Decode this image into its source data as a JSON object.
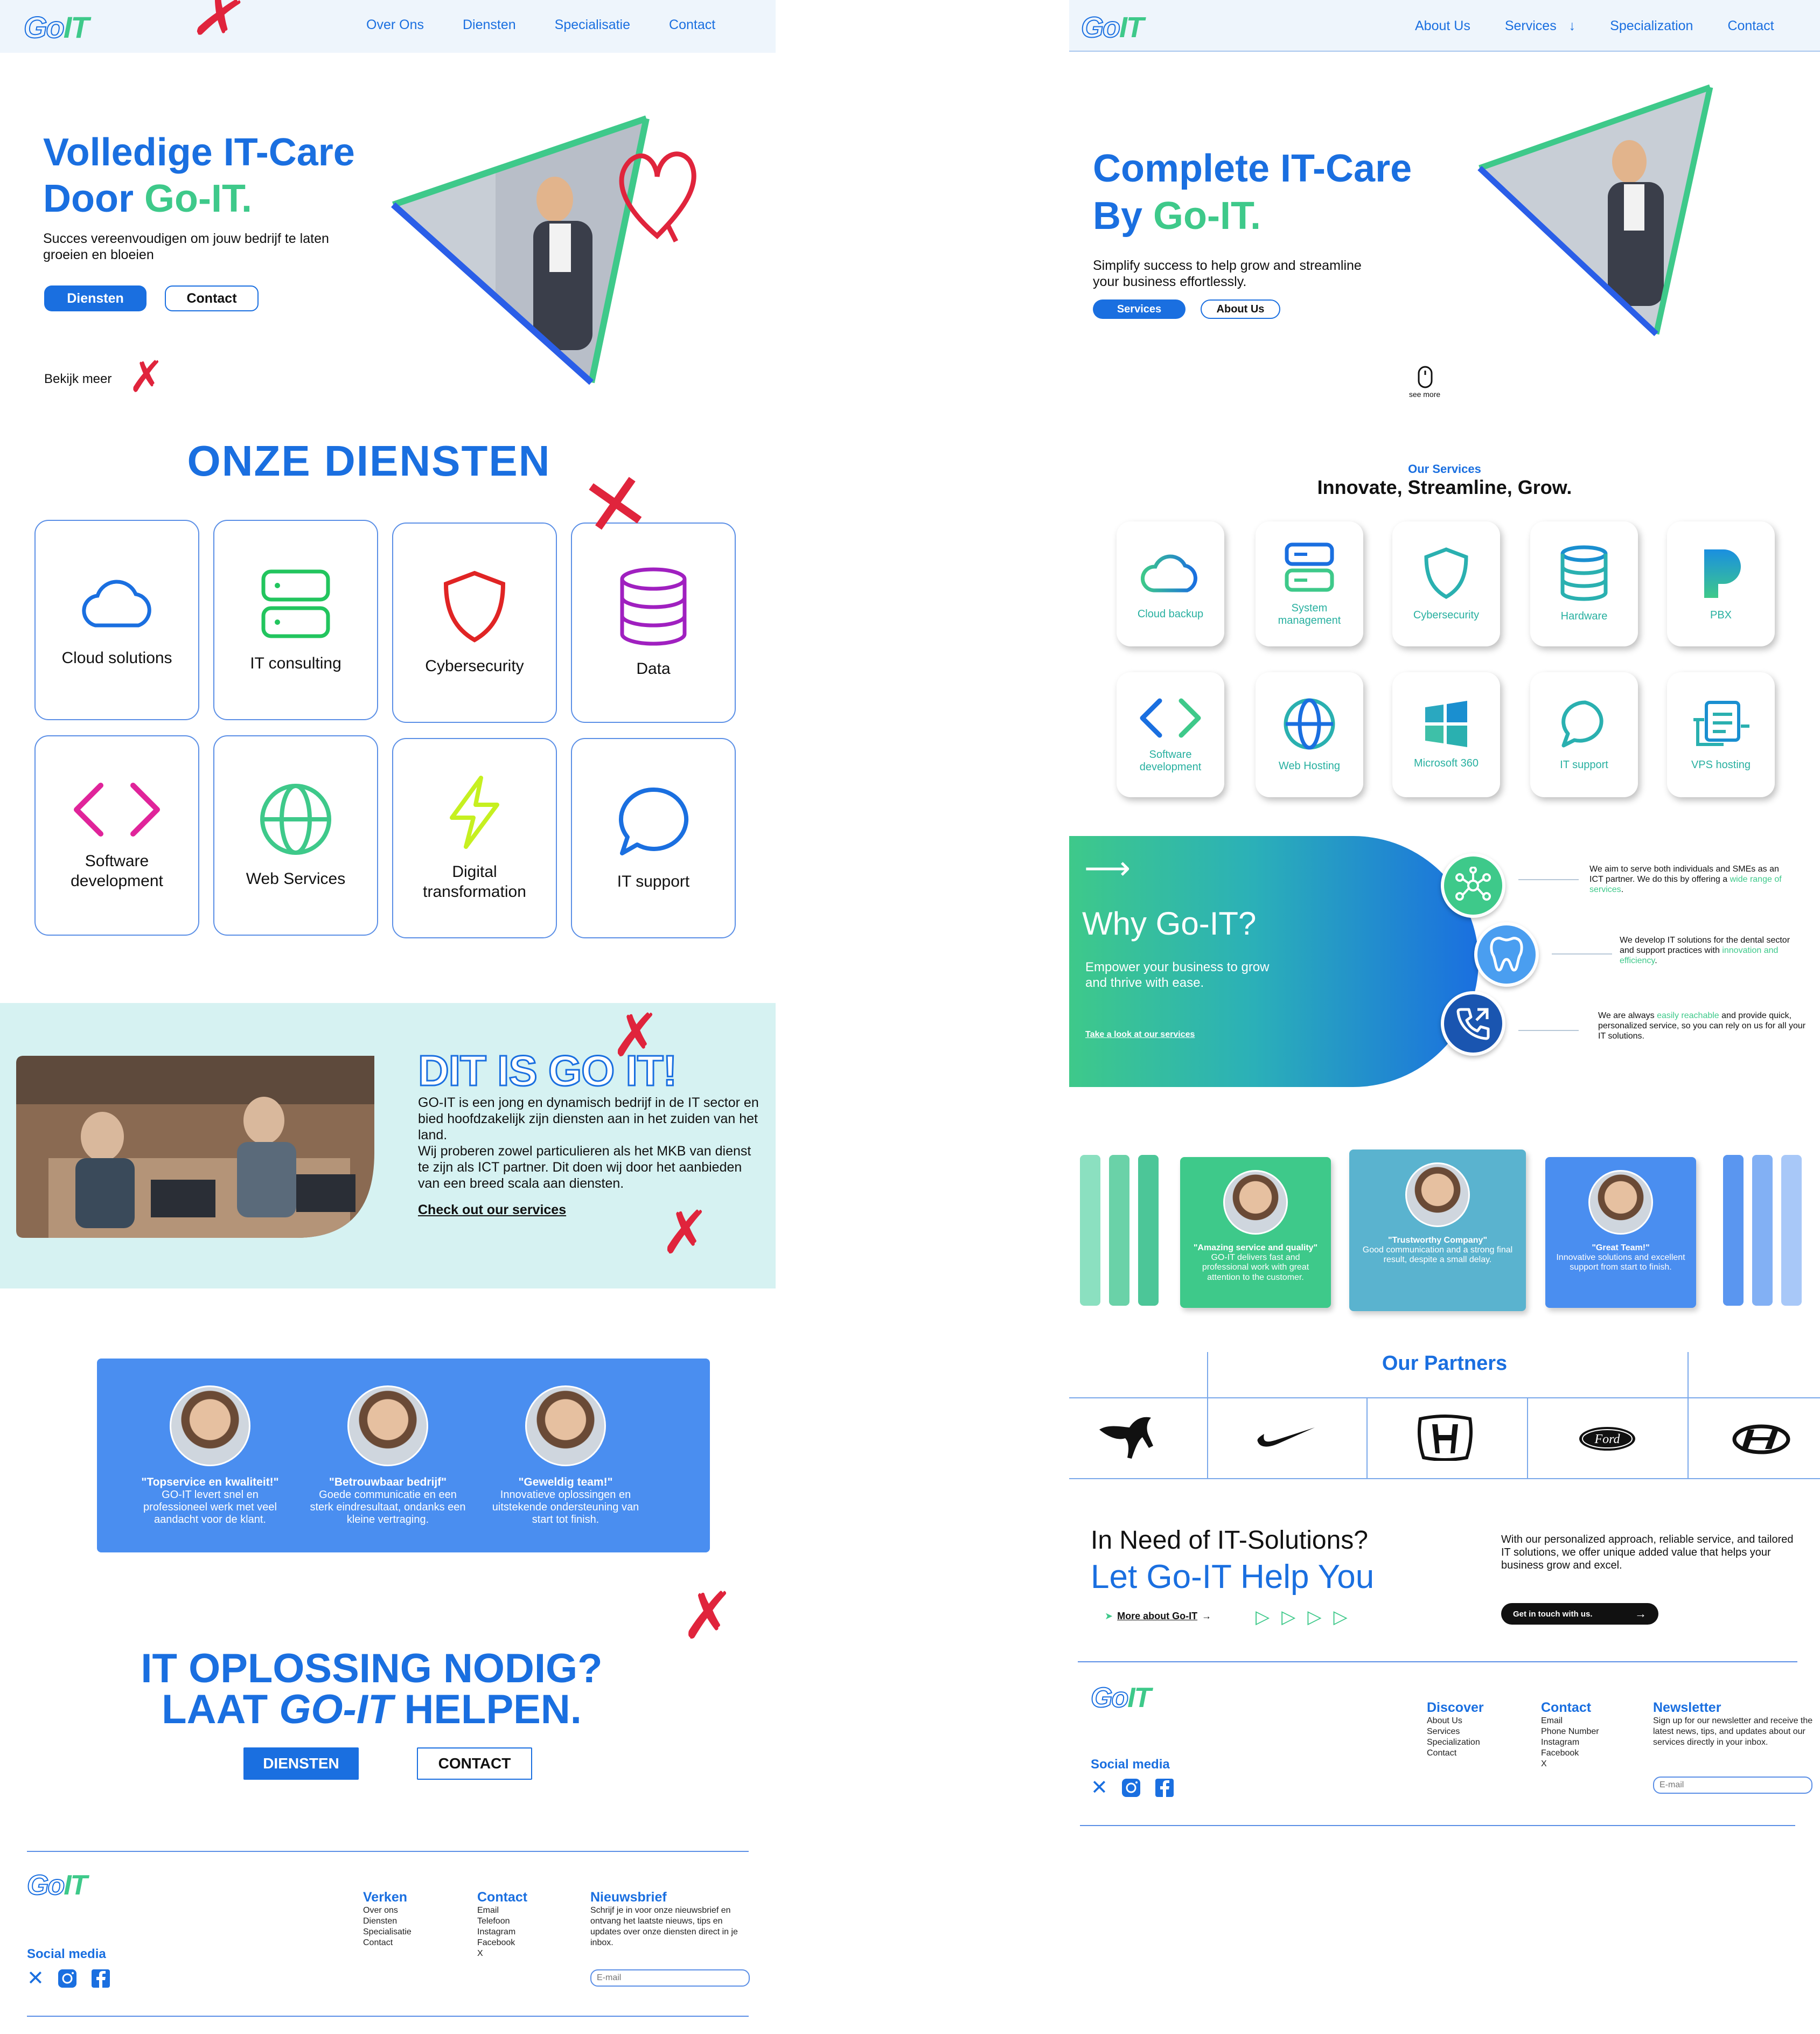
{
  "left": {
    "logo": {
      "go": "Go",
      "it": "IT"
    },
    "nav": [
      "Over Ons",
      "Diensten",
      "Specialisatie",
      "Contact"
    ],
    "hero": {
      "title_line1": "Volledige IT-Care",
      "title_door": "Door ",
      "title_brand": "Go-IT.",
      "subtitle": "Succes vereenvoudigen om jouw bedrijf te laten groeien en bloeien",
      "btn_primary": "Diensten",
      "btn_secondary": "Contact",
      "see_more": "Bekijk meer"
    },
    "services": {
      "heading": "ONZE DIENSTEN",
      "items": [
        {
          "label": "Cloud solutions",
          "icon": "cloud-icon",
          "color": "#1a6fe0"
        },
        {
          "label": "IT consulting",
          "icon": "server-icon",
          "color": "#22c55e"
        },
        {
          "label": "Cybersecurity",
          "icon": "shield-icon",
          "color": "#e02424"
        },
        {
          "label": "Data",
          "icon": "database-icon",
          "color": "#a020c0"
        },
        {
          "label": "Software development",
          "icon": "code-icon",
          "color": "#e0249a"
        },
        {
          "label": "Web Services",
          "icon": "globe-icon",
          "color": "#3ec98a"
        },
        {
          "label": "Digital transformation",
          "icon": "lightning-icon",
          "color": "#c6f020"
        },
        {
          "label": "IT support",
          "icon": "chat-bubble-icon",
          "color": "#1a6fe0"
        }
      ]
    },
    "about": {
      "title": "DIT IS GO IT!",
      "body1": "GO-IT is een jong en dynamisch bedrijf in de IT sector en bied hoofdzakelijk zijn diensten aan in het zuiden van het land.",
      "body2": "Wij proberen zowel particulieren als het MKB van dienst te zijn als ICT partner. Dit doen wij door het aanbieden van een  breed scala aan diensten.",
      "link": "Check out our services",
      "bg": "#d6f2f2"
    },
    "testimonials": [
      {
        "quote": "\"Topservice en kwaliteit!\"",
        "text": "GO-IT levert snel en professioneel werk met veel aandacht voor de klant."
      },
      {
        "quote": "\"Betrouwbaar bedrijf\"",
        "text": "Goede communicatie en een sterk eindresultaat, ondanks een kleine vertraging."
      },
      {
        "quote": "\"Geweldig team!\"",
        "text": "Innovatieve oplossingen en uitstekende ondersteuning van start tot finish."
      }
    ],
    "cta": {
      "line1": "IT OPLOSSING NODIG?",
      "line2_a": "LAAT ",
      "line2_b": "GO-IT",
      "line2_c": " HELPEN.",
      "btn_primary": "DIENSTEN",
      "btn_secondary": "CONTACT"
    },
    "footer": {
      "social_label": "Social media",
      "col1_title": "Verken",
      "col1": [
        "Over ons",
        "Diensten",
        "Specialisatie",
        "Contact"
      ],
      "col2_title": "Contact",
      "col2": [
        "Email",
        "Telefoon",
        "Instagram",
        "Facebook",
        "X"
      ],
      "col3_title": "Nieuwsbrief",
      "col3_text": "Schrijf je in voor onze nieuwsbrief en ontvang het laatste nieuws, tips en updates over onze diensten direct in je inbox.",
      "email_placeholder": "E-mail"
    }
  },
  "right": {
    "logo": {
      "go": "Go",
      "it": "IT"
    },
    "nav": [
      "About Us",
      "Services",
      "Specialization",
      "Contact"
    ],
    "nav_services_arrow": "↓",
    "hero": {
      "title_line1": "Complete IT-Care",
      "title_by": "By ",
      "title_brand": "Go-IT.",
      "subtitle": "Simplify success to help grow and streamline your business effortlessly.",
      "btn_primary": "Services",
      "btn_secondary": "About Us",
      "see_more": "see more"
    },
    "services": {
      "kicker": "Our Services",
      "heading": "Innovate, Streamline, Grow.",
      "items": [
        {
          "label": "Cloud backup",
          "icon": "cloud-icon"
        },
        {
          "label": "System management",
          "icon": "server-icon"
        },
        {
          "label": "Cybersecurity",
          "icon": "shield-icon"
        },
        {
          "label": "Hardware",
          "icon": "database-icon"
        },
        {
          "label": "PBX",
          "icon": "pbx-p-icon"
        },
        {
          "label": "Software development",
          "icon": "code-icon"
        },
        {
          "label": "Web Hosting",
          "icon": "globe-icon"
        },
        {
          "label": "Microsoft 360",
          "icon": "windows-icon"
        },
        {
          "label": "IT support",
          "icon": "chat-bubble-icon"
        },
        {
          "label": "VPS hosting",
          "icon": "vps-icon"
        }
      ]
    },
    "why": {
      "arrow": "⟶",
      "title": "Why Go-IT?",
      "subtitle": "Empower your business to grow and thrive with ease.",
      "link": "Take a look at our services",
      "points": [
        {
          "pre": "We aim to serve both individuals and SMEs as an ICT partner. We do this by offering a ",
          "hl": "wide range of services",
          "post": "."
        },
        {
          "pre": "We develop IT solutions for the dental sector and support practices with ",
          "hl": "innovation and efficiency",
          "post": "."
        },
        {
          "pre": "We are always ",
          "hl": "easily reachable",
          "post": " and provide quick, personalized service, so you can rely on us for all your IT solutions."
        }
      ]
    },
    "testimonials": [
      {
        "quote": "\"Amazing service and quality\"",
        "text": "GO-IT delivers fast and professional work with great attention to the customer.",
        "color": "#3ec98a"
      },
      {
        "quote": "\"Trustworthy Company\"",
        "text": "Good communication and a strong final result, despite a small delay.",
        "color": "#5ab3cf"
      },
      {
        "quote": "\"Great Team!\"",
        "text": "Innovative solutions and excellent support from start to finish.",
        "color": "#4a8ef0"
      }
    ],
    "partners": {
      "title": "Our Partners",
      "logos": [
        "puma-logo-icon",
        "nike-swoosh-icon",
        "honda-logo-icon",
        "ford-logo-icon",
        "hyundai-logo-icon"
      ],
      "ford_text": "Ford"
    },
    "cta": {
      "line1": "In Need of IT-Solutions?",
      "line2": "Let Go-IT Help You",
      "more_link": "More about Go-IT",
      "text": "With our personalized approach, reliable service, and tailored IT solutions, we offer unique added value that helps your business grow and excel.",
      "button": "Get in touch with us."
    },
    "footer": {
      "social_label": "Social media",
      "col1_title": "Discover",
      "col1": [
        "About Us",
        "Services",
        "Specialization",
        "Contact"
      ],
      "col2_title": "Contact",
      "col2": [
        "Email",
        "Phone Number",
        "Instagram",
        "Facebook",
        "X"
      ],
      "col3_title": "Newsletter",
      "col3_text": "Sign up for our newsletter and receive the latest news, tips, and updates about our services directly in your inbox.",
      "email_placeholder": "E-mail"
    }
  },
  "colors": {
    "primary": "#1a6fe0",
    "green": "#3ec98a",
    "annotation_red": "#e0243c"
  }
}
